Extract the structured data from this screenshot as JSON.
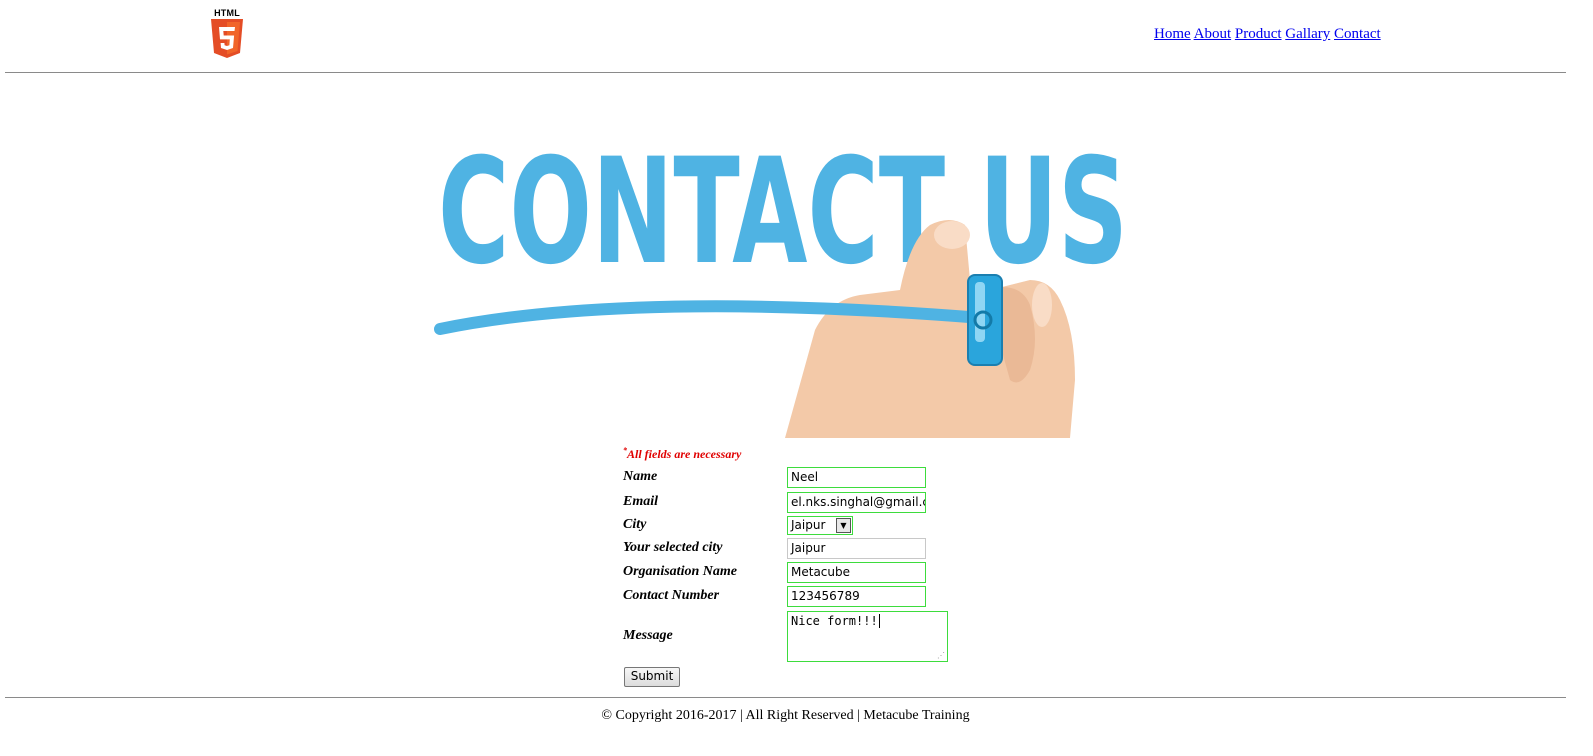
{
  "header": {
    "logo_text": "HTML",
    "nav": [
      "Home",
      "About",
      "Product",
      "Gallary",
      "Contact"
    ]
  },
  "hero": {
    "title": "CONTACT US",
    "color": "#4fb3e3"
  },
  "form": {
    "required_note": "All fields are necessary",
    "required_mark": "*",
    "labels": {
      "name": "Name",
      "email": "Email",
      "city": "City",
      "selected_city": "Your selected city",
      "organisation": "Organisation Name",
      "contact": "Contact Number",
      "message": "Message"
    },
    "values": {
      "name": "Neel",
      "email": "el.nks.singhal@gmail.com",
      "city": "Jaipur",
      "selected_city": "Jaipur",
      "organisation": "Metacube",
      "contact": "123456789",
      "message": "Nice form!!!"
    },
    "submit_label": "Submit",
    "valid_border_color": "#3ddc3d"
  },
  "footer": {
    "text": "© Copyright 2016-2017 | All Right Reserved | Metacube Training"
  }
}
